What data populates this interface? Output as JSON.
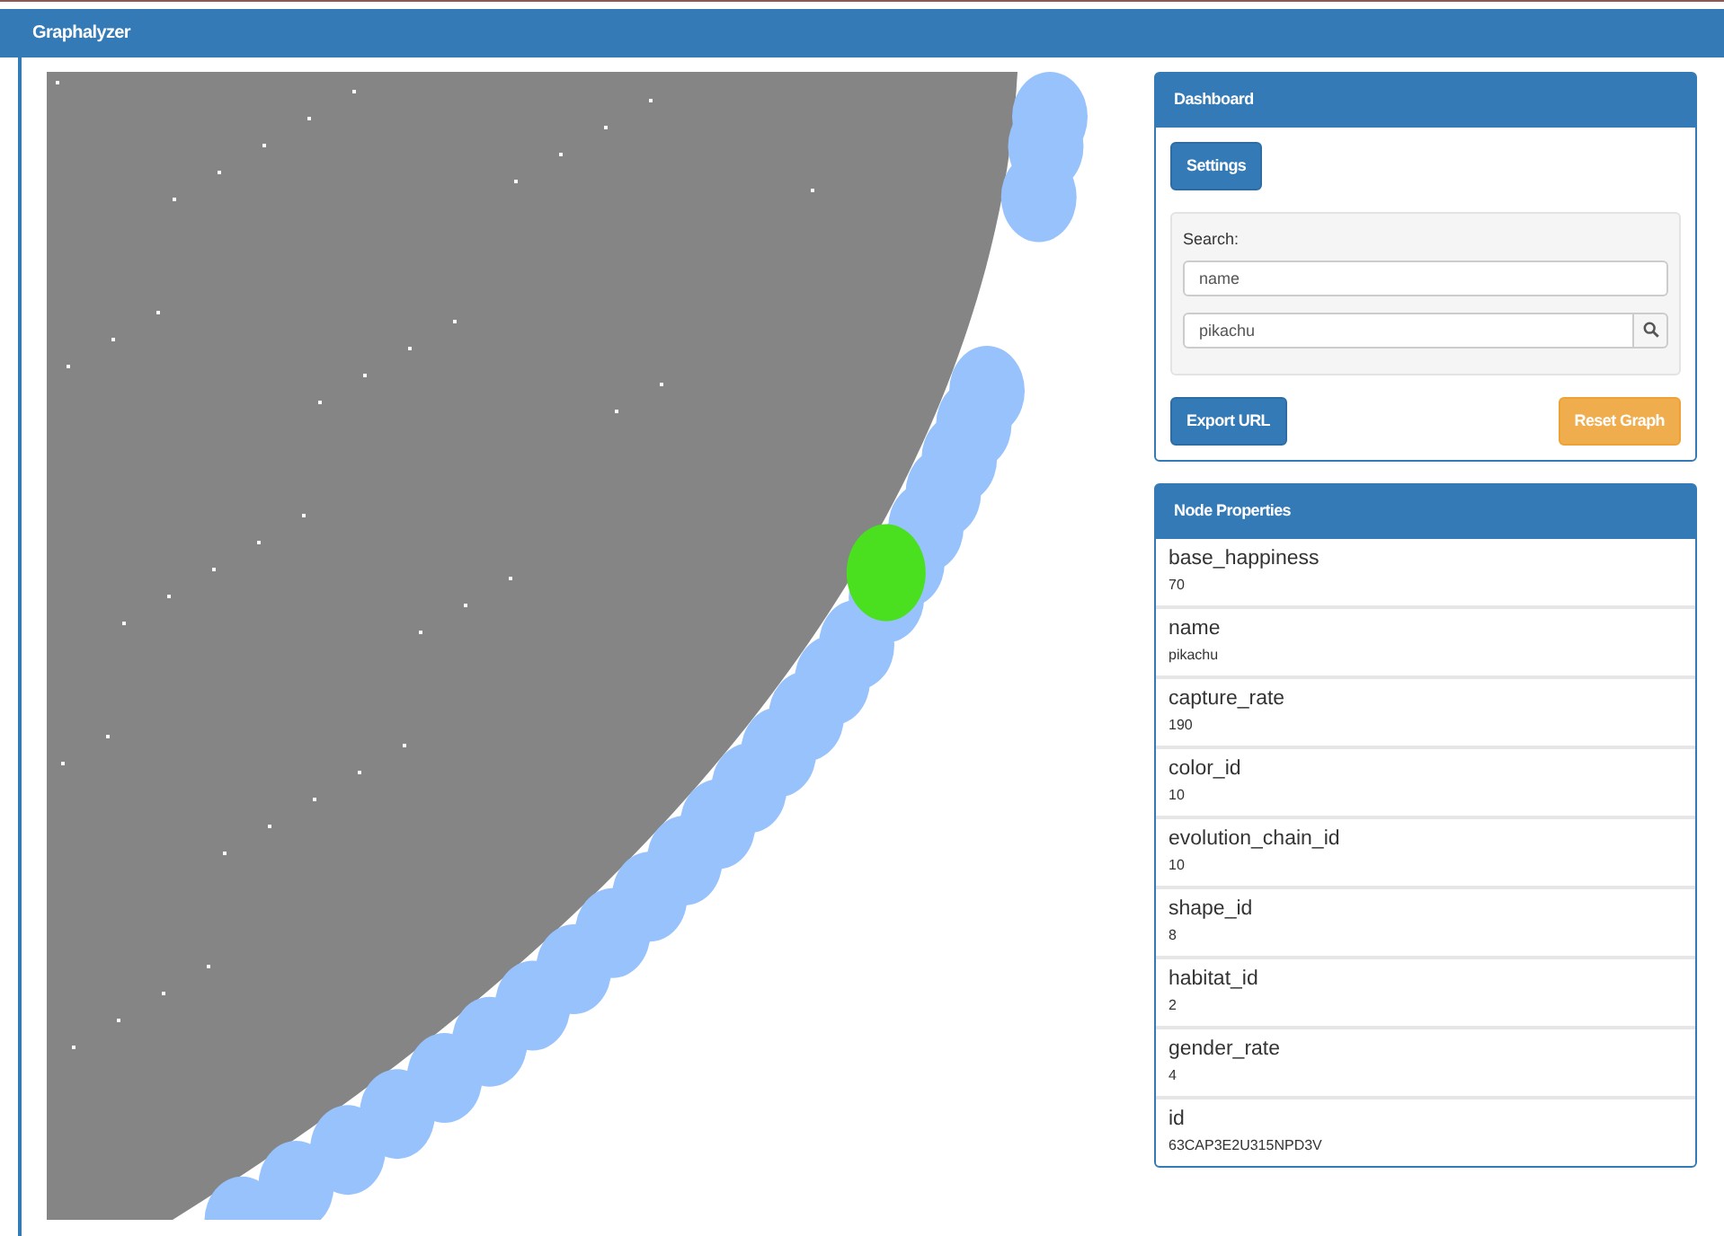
{
  "app_title": "Graphalyzer",
  "dashboard": {
    "title": "Dashboard",
    "settings_button": "Settings",
    "search_label": "Search:",
    "search_field_value": "name",
    "search_value": "pikachu",
    "export_button": "Export URL",
    "reset_button": "Reset Graph"
  },
  "node_properties": {
    "title": "Node Properties",
    "items": [
      {
        "key": "base_happiness",
        "value": "70"
      },
      {
        "key": "name",
        "value": "pikachu"
      },
      {
        "key": "capture_rate",
        "value": "190"
      },
      {
        "key": "color_id",
        "value": "10"
      },
      {
        "key": "evolution_chain_id",
        "value": "10"
      },
      {
        "key": "shape_id",
        "value": "8"
      },
      {
        "key": "habitat_id",
        "value": "2"
      },
      {
        "key": "gender_rate",
        "value": "4"
      },
      {
        "key": "id",
        "value": "63CAP3E2U315NPD3V"
      }
    ]
  }
}
